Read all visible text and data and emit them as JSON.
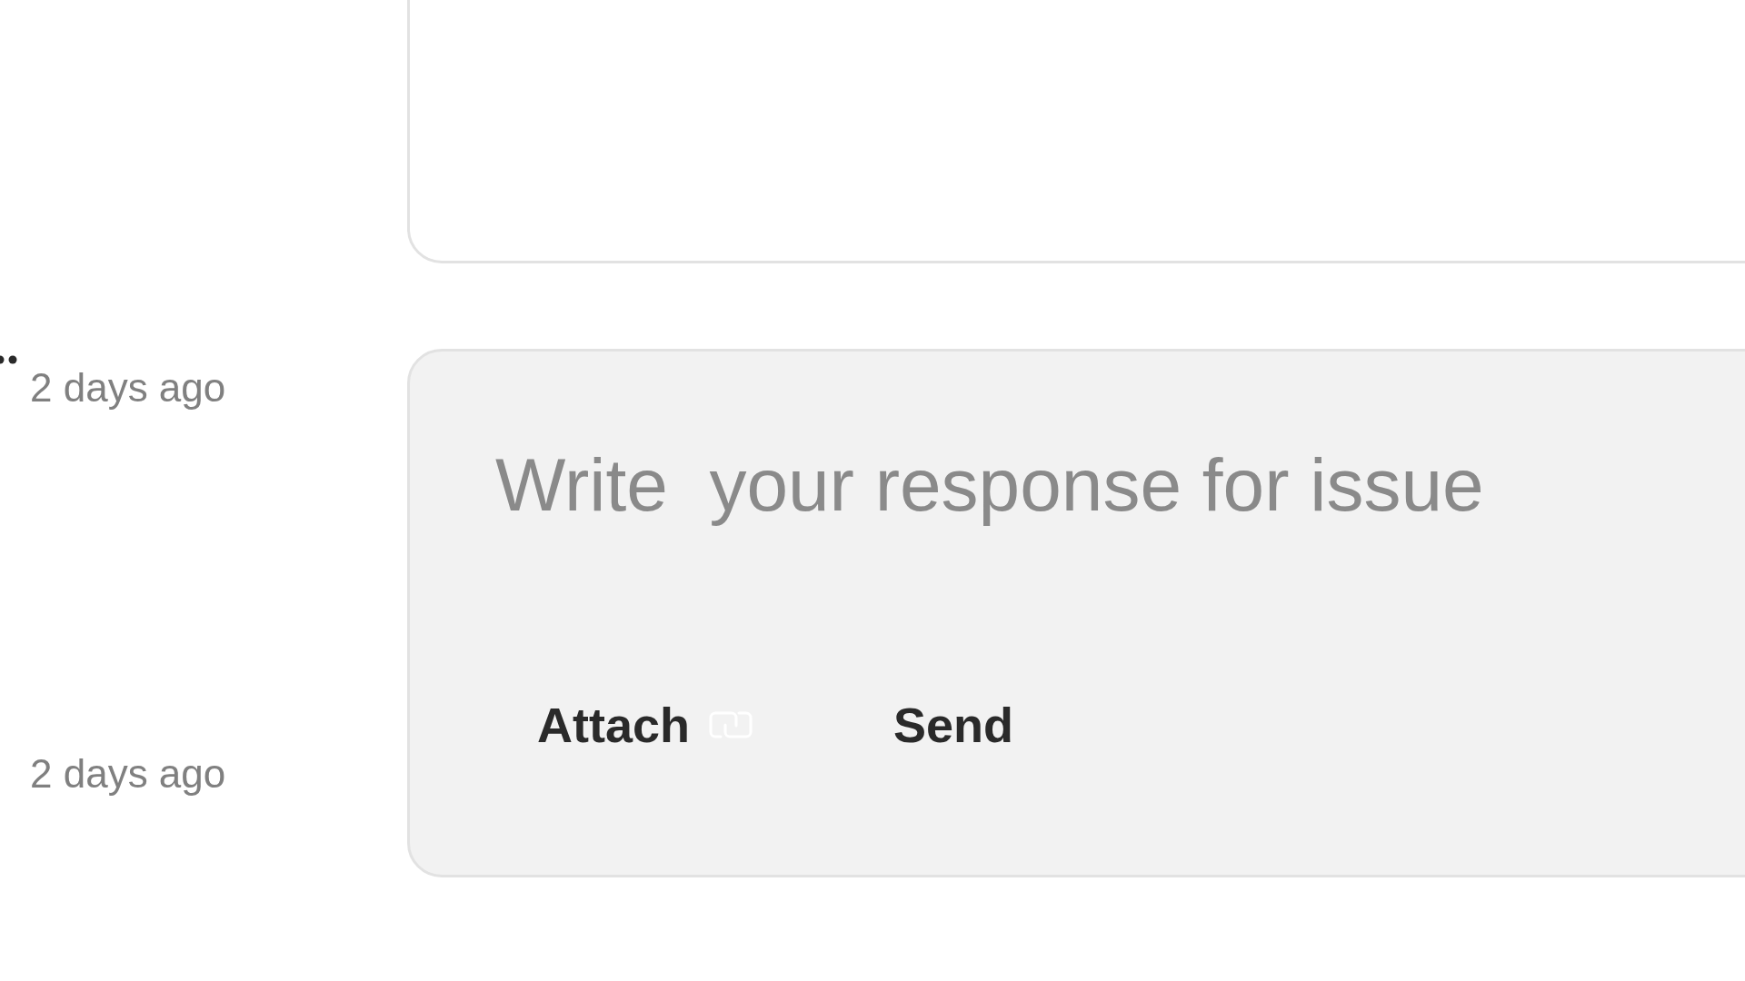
{
  "timestamps": [
    "2 days ago",
    "2 days ago"
  ],
  "composer": {
    "placeholder": "Write  your response for issue",
    "attach_label": "Attach",
    "send_label": "Send"
  }
}
